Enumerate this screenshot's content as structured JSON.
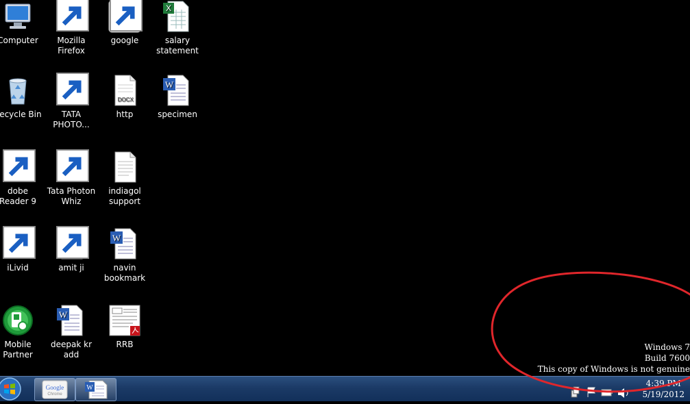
{
  "desktop": {
    "icons": [
      {
        "label": "Computer",
        "icon": "computer-icon"
      },
      {
        "label": "Mozilla Firefox",
        "icon": "firefox-icon"
      },
      {
        "label": "google",
        "icon": "chrome-icon"
      },
      {
        "label": "salary statement",
        "icon": "excel-file-icon"
      },
      {
        "label": "Recycle Bin",
        "icon": "recycle-bin-icon"
      },
      {
        "label": "TATA PHOTO...",
        "icon": "tata-photon-icon"
      },
      {
        "label": "http",
        "icon": "docx-file-icon"
      },
      {
        "label": "specimen",
        "icon": "word-file-icon"
      },
      {
        "label": "dobe Reader 9",
        "icon": "adobe-reader-icon"
      },
      {
        "label": "Tata Photon Whiz",
        "icon": "photon-whiz-icon"
      },
      {
        "label": "indiagol support",
        "icon": "text-file-icon"
      },
      {
        "label": "iLivid",
        "icon": "ilivid-icon"
      },
      {
        "label": "amit ji",
        "icon": "word-file-icon"
      },
      {
        "label": "navin bookmark",
        "icon": "word-file-icon"
      },
      {
        "label": "Mobile Partner",
        "icon": "mobile-partner-icon"
      },
      {
        "label": "deepak kr add",
        "icon": "word-file-icon"
      },
      {
        "label": "RRB",
        "icon": "pdf-file-icon"
      }
    ]
  },
  "watermark": {
    "line1": "Windows 7",
    "line2": "Build 7600",
    "line3": "This copy of Windows is not genuine"
  },
  "annotation": {
    "color": "#e0262b"
  },
  "taskbar": {
    "pinned": [
      {
        "name": "Google Chrome",
        "icon": "chrome-icon",
        "text": "Google Chrome"
      },
      {
        "name": "Microsoft Word",
        "icon": "word-icon",
        "text": "W"
      }
    ],
    "clock": {
      "time": "4:39 PM",
      "date": "5/19/2012"
    }
  }
}
